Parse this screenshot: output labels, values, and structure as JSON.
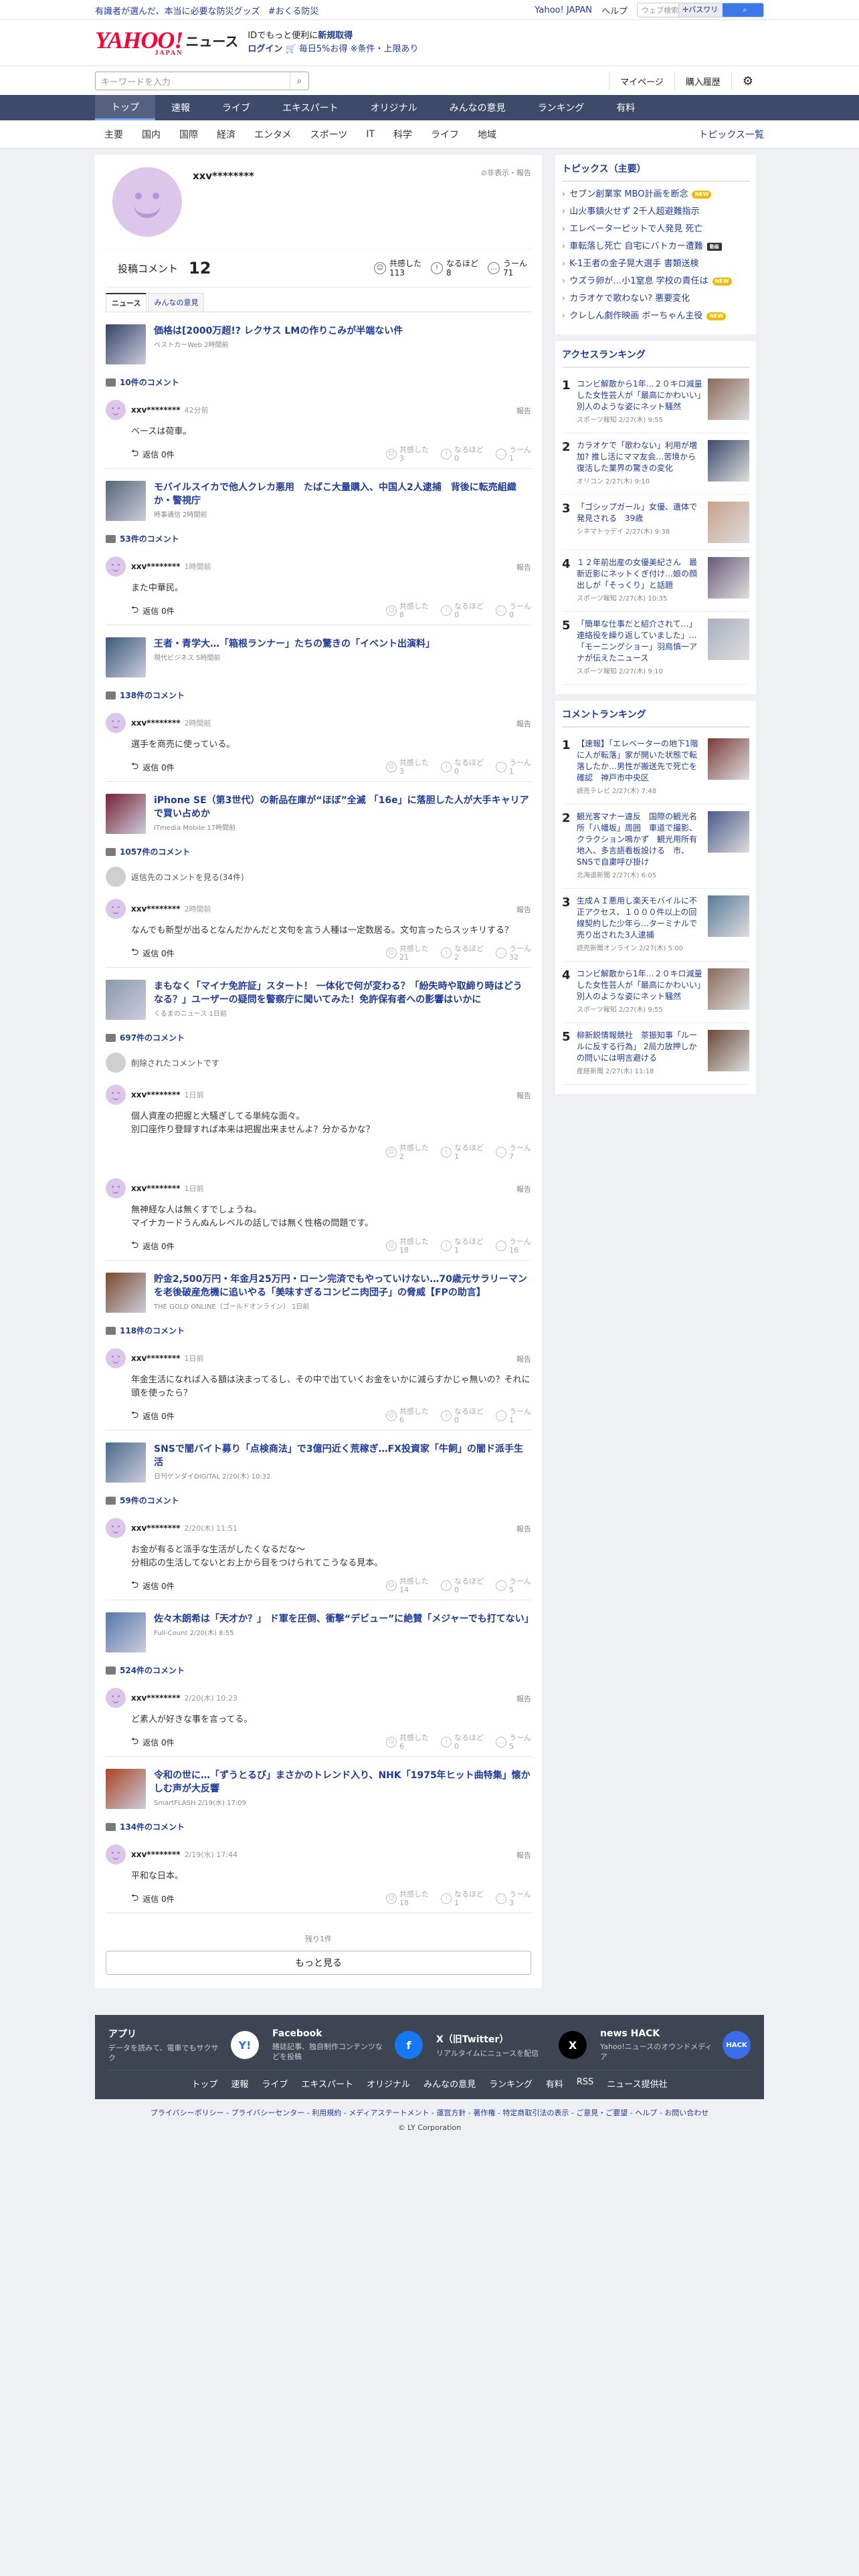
{
  "topbar": {
    "promo": "有識者が選んだ、本当に必要な防災グッズ",
    "hashtag": "#おくる防災",
    "yahoo_link": "Yahoo! JAPAN",
    "help": "ヘルプ",
    "search_placeholder": "ウェブ検索",
    "search_target": "✛パスワリン"
  },
  "header": {
    "logo": "YAHOO!",
    "logo_sub": "JAPAN",
    "service": "ニュース",
    "login_line1": "IDでもっと便利に",
    "login_line1_link": "新規取得",
    "login_link": "ログイン",
    "promo": "毎日5%お得",
    "promo2": "※条件・上限あり"
  },
  "searchrow": {
    "placeholder": "キーワードを入力",
    "mypage": "マイページ",
    "history": "購入履歴"
  },
  "global_nav": [
    "トップ",
    "速報",
    "ライブ",
    "エキスパート",
    "オリジナル",
    "みんなの意見",
    "ランキング",
    "有料"
  ],
  "sub_nav": [
    "主要",
    "国内",
    "国際",
    "経済",
    "エンタメ",
    "スポーツ",
    "IT",
    "科学",
    "ライフ",
    "地域"
  ],
  "sub_nav_right": "トピックス一覧",
  "profile": {
    "name": "xxv********",
    "hide": "非表示・報告",
    "posts_label": "投稿コメント",
    "posts_count": "12",
    "react1_label": "共感した",
    "react1": "113",
    "react2_label": "なるほど",
    "react2": "8",
    "react3_label": "うーん",
    "react3": "71",
    "tab_news": "ニュース",
    "tab_opinion": "みんなの意見"
  },
  "articles": [
    {
      "title": "価格は[2000万超!? レクサス LMの作りこみが半端ない件",
      "meta": "ベストカーWeb 2時間前",
      "count": "10件のコメント",
      "comments": [
        {
          "name": "xxv********",
          "time": "42分前",
          "body": "ベースは荷車。",
          "reply": "返信 0件",
          "v1": "3",
          "v2": "0",
          "v3": "1"
        }
      ]
    },
    {
      "title": "モバイルスイカで他人クレカ悪用　たばこ大量購入、中国人2人逮捕　背後に転売組織か・警視庁",
      "meta": "時事通信 2時間前",
      "count": "53件のコメント",
      "comments": [
        {
          "name": "xxv********",
          "time": "1時間前",
          "body": "また中華民。",
          "reply": "返信 0件",
          "v1": "8",
          "v2": "0",
          "v3": "0"
        }
      ]
    },
    {
      "title": "王者・青学大…「箱根ランナー」たちの驚きの「イベント出演料」",
      "meta": "現代ビジネス 5時間前",
      "count": "138件のコメント",
      "comments": [
        {
          "name": "xxv********",
          "time": "2時間前",
          "body": "選手を商売に使っている。",
          "reply": "返信 0件",
          "v1": "3",
          "v2": "0",
          "v3": "1"
        }
      ]
    },
    {
      "title": "iPhone SE（第3世代）の新品在庫が“ほぼ”全滅 「16e」に落胆した人が大手キャリアで買い占めか",
      "meta": "ITmedia Mobile 17時間前",
      "count": "1057件のコメント",
      "system": "返信先のコメントを見る(34件)",
      "comments": [
        {
          "name": "xxv********",
          "time": "2時間前",
          "body": "なんでも新型が出るとなんだかんだと文句を言う人種は一定数居る。文句言ったらスッキリする？",
          "reply": "返信 0件",
          "v1": "21",
          "v2": "2",
          "v3": "32"
        }
      ]
    },
    {
      "title": "まもなく「マイナ免許証」スタート！ 一体化で何が変わる？「紛失時や取締り時はどうなる？」ユーザーの疑問を警察庁に聞いてみた！免許保有者への影響はいかに",
      "meta": "くるまのニュース 1日前",
      "count": "697件のコメント",
      "system": "削除されたコメントです",
      "comments": [
        {
          "name": "xxv********",
          "time": "1日前",
          "body": "個人資産の把握と大騒ぎしてる単純な面々。\n別口座作り登録すれば本来は把握出来ませんよ？分かるかな？",
          "reply": "",
          "v1": "2",
          "v2": "1",
          "v3": "7"
        },
        {
          "name": "xxv********",
          "time": "1日前",
          "body": "無神経な人は無くすでしょうね。\nマイナカードうんぬんレベルの話しでは無く性格の問題です。",
          "reply": "返信 0件",
          "v1": "18",
          "v2": "1",
          "v3": "16"
        }
      ]
    },
    {
      "title": "貯金2,500万円・年金月25万円・ローン完済でもやっていけない…70歳元サラリーマンを老後破産危機に追いやる「美味すぎるコンビニ肉団子」の脅威【FPの助言】",
      "meta": "THE GOLD ONLINE（ゴールドオンライン） 1日前",
      "count": "118件のコメント",
      "comments": [
        {
          "name": "xxv********",
          "time": "1日前",
          "body": "年金生活になれば入る額は決まってるし、その中で出ていくお金をいかに減らすかじゃ無いの？それに頭を使ったら？",
          "reply": "返信 0件",
          "v1": "6",
          "v2": "0",
          "v3": "1"
        }
      ]
    },
    {
      "title": "SNSで闇バイト募り「点検商法」で3億円近く荒稼ぎ…FX投資家「牛飼」の闇ド派手生活",
      "meta": "日刊ゲンダイDIGITAL 2/20(木) 10:32",
      "count": "59件のコメント",
      "comments": [
        {
          "name": "xxv********",
          "time": "2/20(木) 11:51",
          "body": "お金が有ると派手な生活がしたくなるだな〜\n分相応の生活してないとお上から目をつけられてこうなる見本。",
          "reply": "返信 0件",
          "v1": "14",
          "v2": "0",
          "v3": "5"
        }
      ]
    },
    {
      "title": "佐々木朗希は「天才か？」 ド軍を圧倒、衝撃“デビュー”に絶賛「メジャーでも打てない」",
      "meta": "Full-Count 2/20(木) 8:55",
      "count": "524件のコメント",
      "comments": [
        {
          "name": "xxv********",
          "time": "2/20(木) 10:23",
          "body": "ど素人が好きな事を言ってる。",
          "reply": "返信 0件",
          "v1": "6",
          "v2": "0",
          "v3": "5"
        }
      ]
    },
    {
      "title": "令和の世に…「ずうとるび」まさかのトレンド入り、NHK「1975年ヒット曲特集」懐かしむ声が大反響",
      "meta": "SmartFLASH 2/19(水) 17:09",
      "count": "134件のコメント",
      "comments": [
        {
          "name": "xxv********",
          "time": "2/19(水) 17:44",
          "body": "平和な日本。",
          "reply": "返信 0件",
          "v1": "18",
          "v2": "1",
          "v3": "3"
        }
      ]
    }
  ],
  "vote_labels": {
    "a": "共感した",
    "b": "なるほど",
    "c": "うーん"
  },
  "report": "報告",
  "more": {
    "remaining": "残り1件",
    "button": "もっと見る"
  },
  "sidebar": {
    "topics_title": "トピックス（主要）",
    "topics": [
      {
        "t": "セブン創業家 MBO計画を断念",
        "b": "NEW"
      },
      {
        "t": "山火事鎮火せず 2千人超避難指示",
        "b": ""
      },
      {
        "t": "エレベーターピットで人発見 死亡",
        "b": ""
      },
      {
        "t": "車転落し死亡 自宅にバトカー遭難",
        "b": "動画"
      },
      {
        "t": "K-1王者の金子晃大選手 書類送検",
        "b": ""
      },
      {
        "t": "ウズラ卵が…小1窒息 学校の責任は",
        "b": "NEW"
      },
      {
        "t": "カラオケで歌わない? 悪要変化",
        "b": ""
      },
      {
        "t": "クレしん劇作映画 ボーちゃん主役",
        "b": "NEW"
      }
    ],
    "access_title": "アクセスランキング",
    "access": [
      {
        "t": "コンビ解散から1年…２０キロ減量した女性芸人が「最高にかわいい」別人のような姿にネット騒然",
        "s": "スポーツ報知 2/27(木) 9:55"
      },
      {
        "t": "カラオケで「歌わない」利用が増加? 推し活にママ友会…苦境から復活した業界の驚きの変化",
        "s": "オリコン 2/27(木) 9:10"
      },
      {
        "t": "「ゴシップガール」女優、遺体で発見される　39歳",
        "s": "シネマトゥデイ 2/27(木) 9:38"
      },
      {
        "t": "１２年前出産の女優美紀さん　最新近影にネットくぎ付け…娘の顔出しが「そっくり」と話題",
        "s": "スポーツ報知 2/27(木) 10:35"
      },
      {
        "t": "「簡単な仕事だと紹介されて…」連絡役を繰り返していました」…「モーニングショー」羽鳥慎一アナが伝えたニュース",
        "s": "スポーツ報知 2/27(木) 9:10"
      }
    ],
    "comment_title": "コメントランキング",
    "comment": [
      {
        "t": "【速報】「エレベーターの地下1階に人が転落」家が開いた状態で転落したか…男性が搬送先で死亡を確認　神戸市中央区",
        "s": "読売テレビ 2/27(木) 7:48"
      },
      {
        "t": "観光客マナー違反　国際の観光名所「八幡坂」周囲　車道で撮影、クラクション鳴かず　観光用所有地入、多言語看板設ける　市、SNSで自粛呼び掛け",
        "s": "北海道新聞 2/27(木) 6:05"
      },
      {
        "t": "生成ＡＩ悪用し楽天モバイルに不正アクセス、１０００件以上の回線契約した少年ら…ターミナルで売り出された3人逮捕",
        "s": "読売新聞オンライン 2/27(木) 5:00"
      },
      {
        "t": "コンビ解散から1年…２０キロ減量した女性芸人が「最高にかわいい」別人のような姿にネット騒然",
        "s": "スポーツ報知 2/27(木) 9:55"
      },
      {
        "t": "柳新鋭情報競社　茶振知事「ルールに反する行為」 2局力放押しかの問いには明言避ける",
        "s": "産経新聞 2/27(木) 11:18"
      }
    ]
  },
  "footer": {
    "apps": [
      {
        "t1": "アプリ",
        "t2": "データを読みて、電車でもサクサク",
        "icon": "Y!"
      },
      {
        "t1": "Facebook",
        "t2": "雑誌記事、独自制作コンテンツなどを投稿",
        "icon": "f"
      },
      {
        "t1": "X（旧Twitter）",
        "t2": "リアルタイムにニュースを配信",
        "icon": "X"
      },
      {
        "t1": "news HACK",
        "t2": "Yahoo!ニュースのオウンドメディア",
        "icon": "HACK"
      }
    ],
    "links": [
      "トップ",
      "速報",
      "ライブ",
      "エキスパート",
      "オリジナル",
      "みんなの意見",
      "ランキング",
      "有料",
      "RSS",
      "ニュース提供社"
    ],
    "sub": "プライバシーポリシー - プライバシーセンター - 利用規約 - メディアステートメント - 運営方針 - 著作権 - 特定商取引法の表示 - ご意見・ご要望 - ヘルプ - お問い合わせ",
    "copy": "© LY Corporation"
  }
}
